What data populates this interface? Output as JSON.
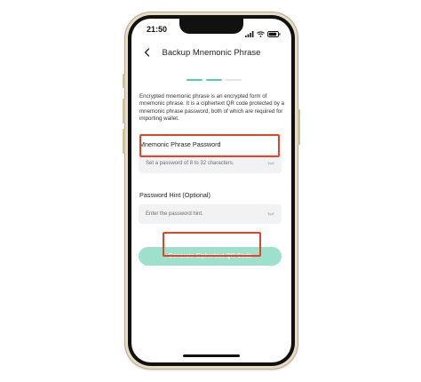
{
  "status_bar": {
    "time": "21:50"
  },
  "header": {
    "title": "Backup Mnemonic Phrase",
    "back_icon": "chevron-left-icon"
  },
  "steps": {
    "total": 3,
    "completed": 2,
    "active_color": "#5cc9a7",
    "inactive_color": "#e3e3e3"
  },
  "description": "Encrypted mnemonic phrase is an encrypted form of mnemonic phrase. It is a ciphertext QR code protected by a mnemonic phrase password, both of which are required for importing wallet.",
  "password_field": {
    "label": "Mnemonic Phrase Password",
    "placeholder": "Set a password of 8 to 32 characters.",
    "icon": "eye-closed-icon"
  },
  "hint_field": {
    "label": "Password Hint (Optional)",
    "placeholder": "Enter the password hint.",
    "icon": "eye-closed-icon"
  },
  "generate_button": {
    "label": "Generate Ciphertext QR Code",
    "color": "#9fe0cd"
  },
  "highlight_color": "#e0452c"
}
